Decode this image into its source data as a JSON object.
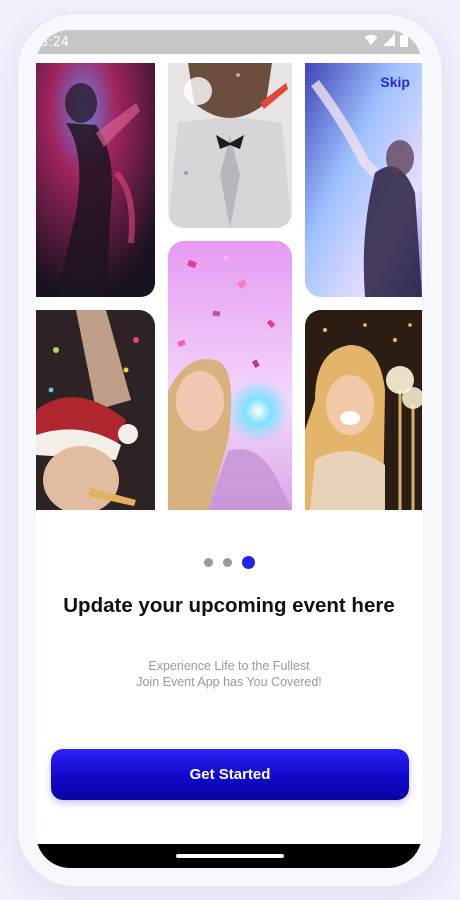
{
  "status_bar": {
    "time": "3:24",
    "icons": [
      "wifi-icon",
      "cellular-signal-icon",
      "battery-icon"
    ]
  },
  "gallery": {
    "photos": [
      {
        "name": "club-dancer-photo",
        "palette": [
          "#7a1f4a",
          "#2b1a3a",
          "#e14a8a"
        ]
      },
      {
        "name": "party-horn-man-photo",
        "palette": [
          "#f2e9e4",
          "#3a2a22",
          "#c9c2c8"
        ]
      },
      {
        "name": "blue-light-dancer-photo",
        "palette": [
          "#7fb4ff",
          "#3d3c9c",
          "#e7d6ff"
        ]
      },
      {
        "name": "santa-hat-woman-photo",
        "palette": [
          "#3b2a2a",
          "#e4c7b0",
          "#b33a3a"
        ]
      },
      {
        "name": "confetti-woman-photo",
        "palette": [
          "#e39cf0",
          "#f7d6ff",
          "#60c8ff"
        ]
      },
      {
        "name": "sparkler-woman-photo",
        "palette": [
          "#3a2616",
          "#e8b46a",
          "#f3e3c8"
        ]
      }
    ]
  },
  "skip": {
    "label": "Skip"
  },
  "pagination": {
    "count": 3,
    "active_index": 2
  },
  "onboarding": {
    "title": "Update your upcoming event here",
    "subtitle_line1": "Experience Life to the Fullest",
    "subtitle_line2": "Join Event App has You Covered!"
  },
  "cta": {
    "label": "Get Started"
  },
  "colors": {
    "accent": "#2424e6",
    "skip_text": "#2b27d9",
    "title_text": "#111111",
    "subtitle_text": "#9a9a9a",
    "button_gradient_top": "#2a24f2",
    "button_gradient_bottom": "#0a039e"
  }
}
